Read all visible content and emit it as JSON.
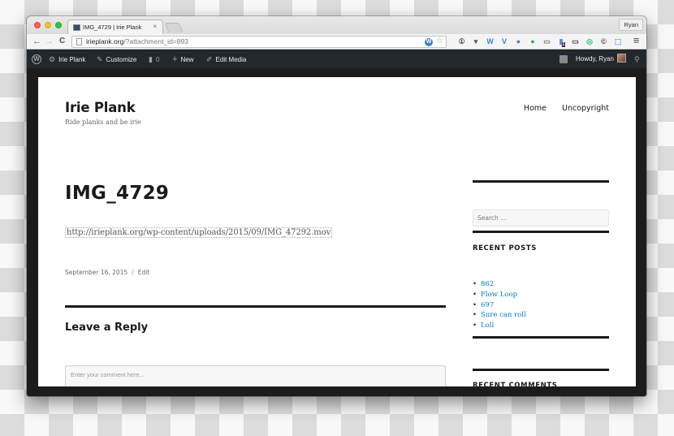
{
  "browser": {
    "tab_title": "IMG_4729 | Irie Plank",
    "tab_close": "×",
    "profile_name": "Ryan",
    "url_host": "irieplank.org",
    "url_path": "/?attachment_id=893",
    "nav": {
      "back": "←",
      "forward": "→",
      "reload": "C"
    },
    "extensions": [
      {
        "name": "onepassword-icon",
        "glyph": "①",
        "color": "#555555"
      },
      {
        "name": "pocket-icon",
        "glyph": "▾",
        "color": "#555555"
      },
      {
        "name": "wordpress-icon",
        "glyph": "W",
        "color": "#3f83c4"
      },
      {
        "name": "vimeo-icon",
        "glyph": "V",
        "color": "#1a8fd6"
      },
      {
        "name": "globe-icon",
        "glyph": "●",
        "color": "#4a7fd0"
      },
      {
        "name": "evernote-icon",
        "glyph": "●",
        "color": "#2ab14a"
      },
      {
        "name": "cast-icon",
        "glyph": "▭",
        "color": "#777777"
      },
      {
        "name": "badge-extension-icon",
        "glyph": "▮",
        "color": "#5b8fd6",
        "badge": "1"
      },
      {
        "name": "screen-share-icon",
        "glyph": "▭",
        "color": "#444444"
      },
      {
        "name": "grammarly-icon",
        "glyph": "◎",
        "color": "#2bbf7a"
      },
      {
        "name": "copyright-icon",
        "glyph": "©",
        "color": "#444444"
      },
      {
        "name": "fullscreen-icon",
        "glyph": "⬚",
        "color": "#5b8fd6"
      }
    ],
    "menu_glyph": "≡"
  },
  "adminbar": {
    "site_name": "Irie Plank",
    "customize": "Customize",
    "comments_count": "0",
    "new": "New",
    "edit_media": "Edit Media",
    "howdy": "Howdy, Ryan"
  },
  "site": {
    "title": "Irie Plank",
    "description": "Ride planks and be irie",
    "nav": [
      "Home",
      "Uncopyright"
    ]
  },
  "entry": {
    "title": "IMG_4729",
    "attachment_url": "http://irieplank.org/wp-content/uploads/2015/09/IMG_47292.mov",
    "date": "September 16, 2015",
    "separator": "/",
    "edit": "Edit"
  },
  "comments": {
    "reply_title": "Leave a Reply",
    "placeholder": "Enter your comment here..."
  },
  "sidebar": {
    "search_placeholder": "Search …",
    "recent_posts_title": "RECENT POSTS",
    "recent_posts": [
      "862",
      "Flow Loop",
      "697",
      "Sure can roll",
      "Loll"
    ],
    "recent_comments_title": "RECENT COMMENTS"
  },
  "colors": {
    "link": "#007acc",
    "adminbar_bg": "#23282d",
    "text": "#1a1a1a"
  }
}
